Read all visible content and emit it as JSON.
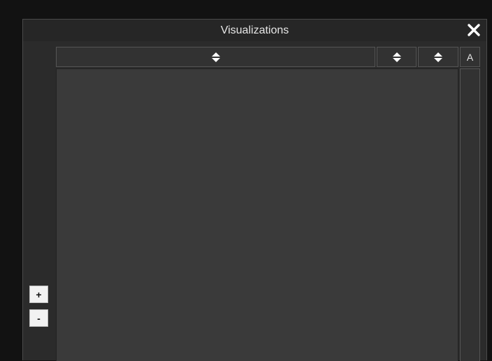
{
  "dialog": {
    "title": "Visualizations",
    "close_icon": "close-icon"
  },
  "table": {
    "columns": [
      {
        "icon": "sort-icon"
      },
      {
        "icon": "sort-icon"
      },
      {
        "icon": "sort-icon"
      },
      {
        "label": "A"
      }
    ]
  },
  "zoom": {
    "plus_label": "+",
    "minus_label": "-"
  },
  "colors": {
    "page_bg": "#121212",
    "dialog_bg": "#2b2b2b",
    "grid_bg": "#3a3a3a",
    "header_bg": "#323232",
    "text": "#e6e6e6"
  }
}
